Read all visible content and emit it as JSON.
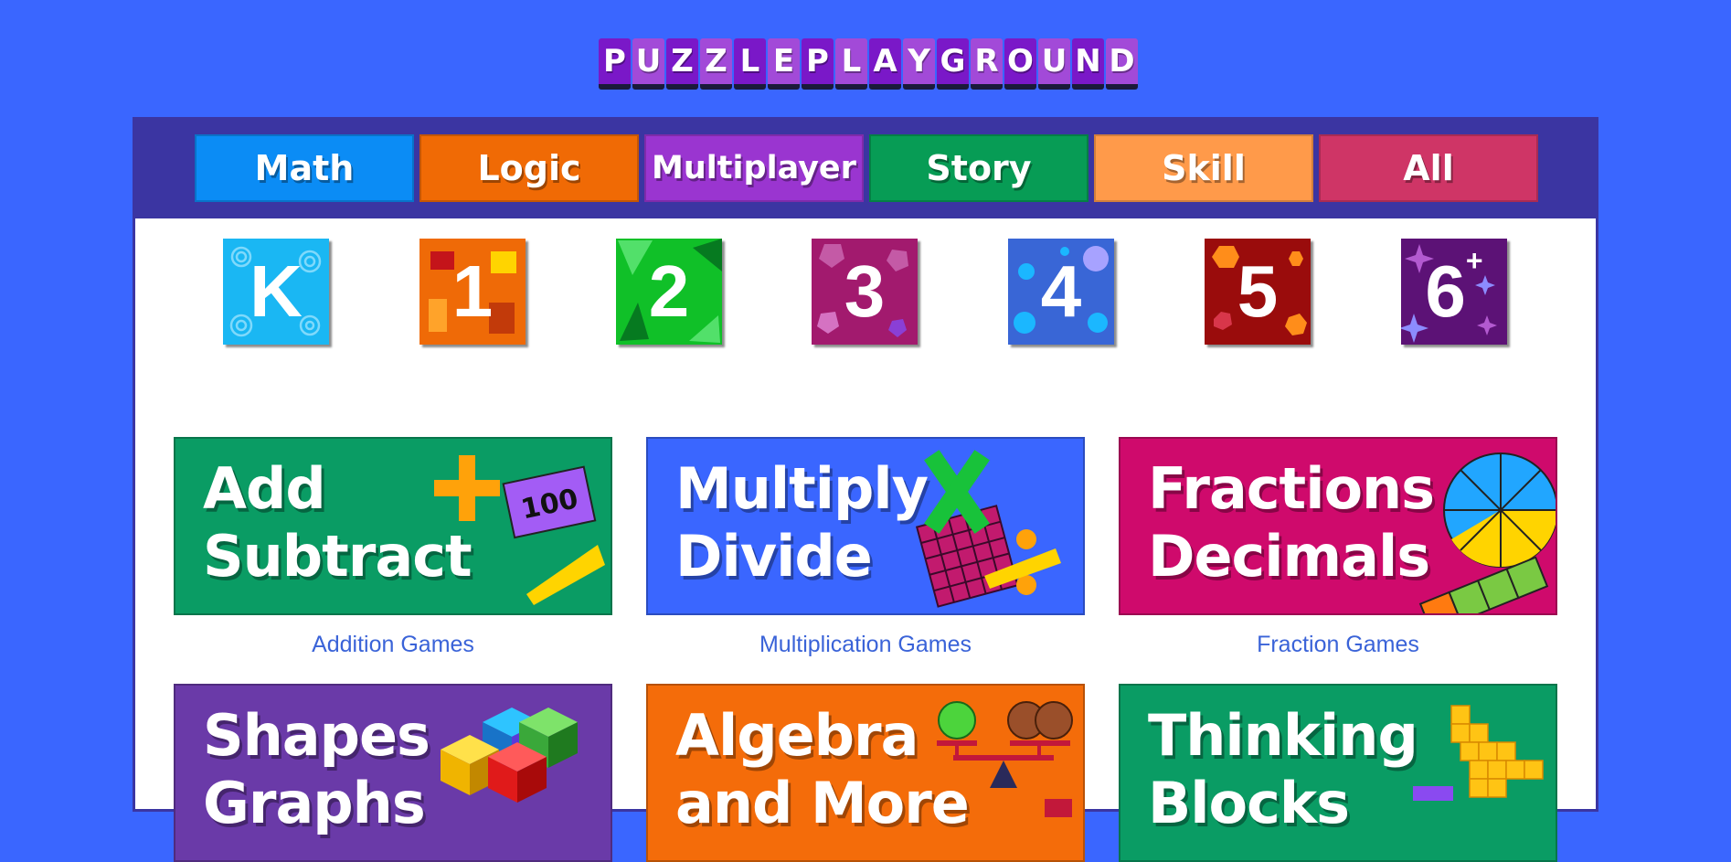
{
  "logo": {
    "letters": [
      "P",
      "U",
      "Z",
      "Z",
      "L",
      "E",
      "P",
      "L",
      "A",
      "Y",
      "G",
      "R",
      "O",
      "U",
      "N",
      "D"
    ],
    "colors": [
      "#7a18c8",
      "#a24ad8",
      "#7a18c8",
      "#a24ad8",
      "#7a18c8",
      "#a24ad8",
      "#7a18c8",
      "#a24ad8",
      "#7a18c8",
      "#a24ad8",
      "#7a18c8",
      "#a24ad8",
      "#7a18c8",
      "#a24ad8",
      "#7a18c8",
      "#a24ad8"
    ]
  },
  "nav": {
    "tabs": [
      {
        "label": "Math",
        "color": "#0b8cf5"
      },
      {
        "label": "Logic",
        "color": "#f06a05"
      },
      {
        "label": "Multiplayer",
        "color": "#9a35d0"
      },
      {
        "label": "Story",
        "color": "#079c55"
      },
      {
        "label": "Skill",
        "color": "#ff9a4a"
      },
      {
        "label": "All",
        "color": "#cf3566"
      }
    ]
  },
  "grades": [
    {
      "label": "K",
      "color": "#1ab7f3"
    },
    {
      "label": "1",
      "color": "#ef6a07"
    },
    {
      "label": "2",
      "color": "#10c028"
    },
    {
      "label": "3",
      "color": "#a21a6e"
    },
    {
      "label": "4",
      "color": "#3966d6"
    },
    {
      "label": "5",
      "color": "#9a0c0c"
    },
    {
      "label": "6",
      "sup": "+",
      "color": "#5c1276"
    }
  ],
  "cards": [
    {
      "title": "Add\nSubtract",
      "color": "#0a9c64",
      "link": "Addition Games",
      "art_text": "100"
    },
    {
      "title": "Multiply\nDivide",
      "color": "#3a66ff",
      "link": "Multiplication Games"
    },
    {
      "title": "Fractions\nDecimals",
      "color": "#cf0a6c",
      "link": "Fraction Games"
    },
    {
      "title": "Shapes\nGraphs",
      "color": "#6a3aa8"
    },
    {
      "title": "Algebra\nand More",
      "color": "#f46c0a"
    },
    {
      "title": "Thinking\nBlocks",
      "color": "#0a9c64"
    }
  ]
}
